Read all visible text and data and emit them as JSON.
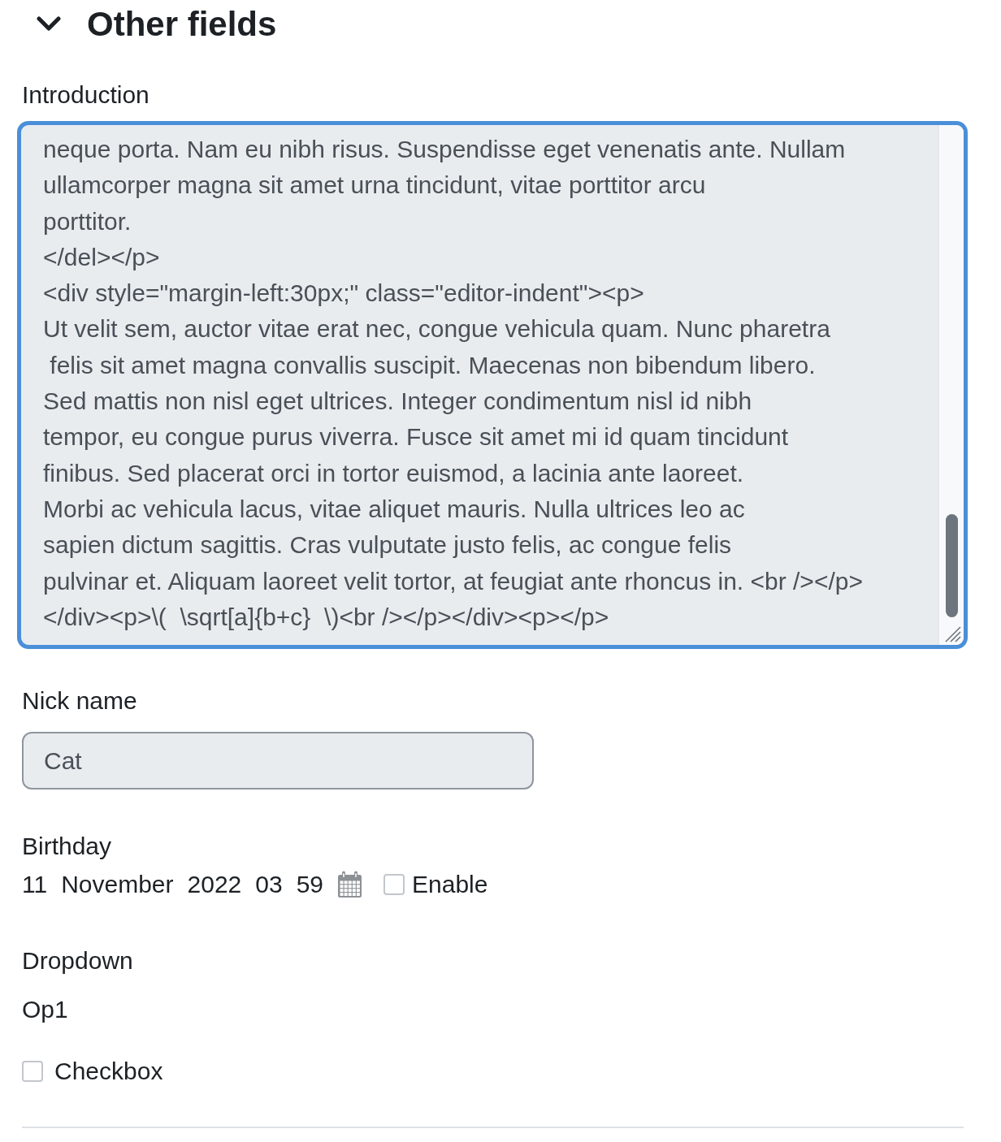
{
  "section": {
    "title": "Other fields",
    "expanded": true
  },
  "introduction": {
    "label": "Introduction",
    "focused": true,
    "readonly": true,
    "value": "neque porta. Nam eu nibh risus. Suspendisse eget venenatis ante. Nullam\nullamcorper magna sit amet urna tincidunt, vitae porttitor arcu\nporttitor.\n</del></p>\n<div style=\"margin-left:30px;\" class=\"editor-indent\"><p>\nUt velit sem, auctor vitae erat nec, congue vehicula quam. Nunc pharetra\n felis sit amet magna convallis suscipit. Maecenas non bibendum libero.\nSed mattis non nisl eget ultrices. Integer condimentum nisl id nibh\ntempor, eu congue purus viverra. Fusce sit amet mi id quam tincidunt\nfinibus. Sed placerat orci in tortor euismod, a lacinia ante laoreet.\nMorbi ac vehicula lacus, vitae aliquet mauris. Nulla ultrices leo ac\nsapien dictum sagittis. Cras vulputate justo felis, ac congue felis\npulvinar et. Aliquam laoreet velit tortor, at feugiat ante rhoncus in. <br /></p>\n</div><p>\\(  \\sqrt[a]{b+c}  \\)<br /></p></div><p></p>"
  },
  "nick_name": {
    "label": "Nick name",
    "value": "Cat",
    "readonly": true
  },
  "birthday": {
    "label": "Birthday",
    "parts": [
      "11",
      "November",
      "2022",
      "03",
      "59"
    ],
    "enable": {
      "label": "Enable",
      "checked": false
    }
  },
  "dropdown": {
    "label": "Dropdown",
    "value": "Op1"
  },
  "checkbox": {
    "label": "Checkbox",
    "checked": false
  }
}
